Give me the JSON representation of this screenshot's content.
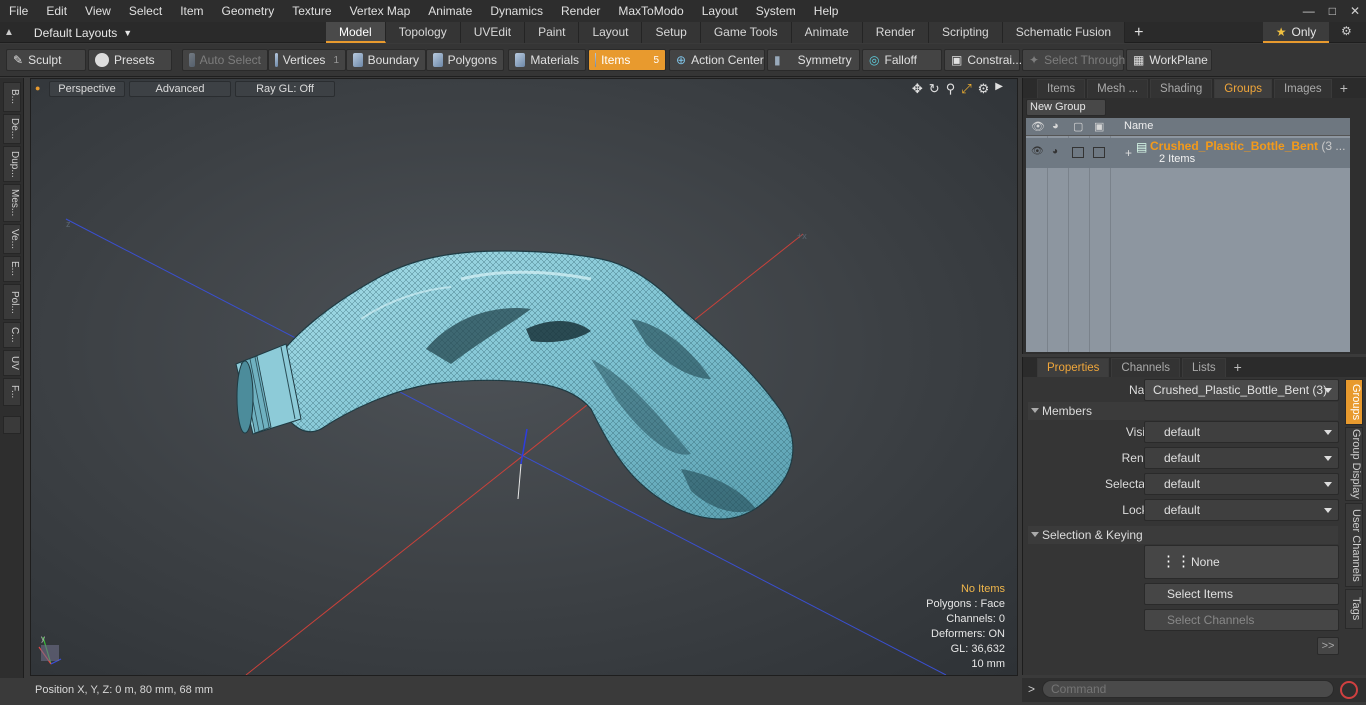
{
  "menu": [
    "File",
    "Edit",
    "View",
    "Select",
    "Item",
    "Geometry",
    "Texture",
    "Vertex Map",
    "Animate",
    "Dynamics",
    "Render",
    "MaxToModo",
    "Layout",
    "System",
    "Help"
  ],
  "layouts_label": "Default Layouts",
  "mode_tabs": [
    "Model",
    "Topology",
    "UVEdit",
    "Paint",
    "Layout",
    "Setup",
    "Game Tools",
    "Animate",
    "Render",
    "Scripting",
    "Schematic Fusion"
  ],
  "active_mode_tab": "Model",
  "only_label": "Only",
  "toolbar": {
    "sculpt": "Sculpt",
    "presets": "Presets",
    "auto_select": "Auto Select",
    "vertices": "Vertices",
    "vertices_count": "1",
    "boundary": "Boundary",
    "polygons": "Polygons",
    "materials": "Materials",
    "items": "Items",
    "items_count": "5",
    "action_center": "Action Center",
    "symmetry": "Symmetry",
    "falloff": "Falloff",
    "constraints": "Constrai...",
    "select_through": "Select Through",
    "workplane": "WorkPlane"
  },
  "left_tabs": [
    "B...",
    "De...",
    "Dup...",
    "Mes...",
    "Ve...",
    "E...",
    "Pol...",
    "C...",
    "UV",
    "F..."
  ],
  "viewport": {
    "view": "Perspective",
    "shading": "Advanced",
    "raygl": "Ray GL: Off",
    "info": {
      "selection": "No Items",
      "polygons": "Polygons : Face",
      "channels": "Channels: 0",
      "deformers": "Deformers: ON",
      "gl": "GL: 36,632",
      "scale": "10 mm"
    }
  },
  "status": "Position X, Y, Z:   0 m, 80 mm, 68 mm",
  "top_panel": {
    "tabs": [
      "Items",
      "Mesh ...",
      "Shading",
      "Groups",
      "Images"
    ],
    "active_tab": "Groups",
    "new_group": "New Group",
    "col_name": "Name",
    "group_name": "Crushed_Plastic_Bottle_Bent",
    "group_count": "(3 ...",
    "group_items": "2 Items"
  },
  "bottom_panel": {
    "tabs": [
      "Properties",
      "Channels",
      "Lists"
    ],
    "active_tab": "Properties",
    "name_label": "Name",
    "name_value": "Crushed_Plastic_Bottle_Bent (3)",
    "members": "Members",
    "visible_label": "Visible",
    "visible_value": "default",
    "render_label": "Render",
    "render_value": "default",
    "selectable_label": "Selectable",
    "selectable_value": "default",
    "locked_label": "Locked",
    "locked_value": "default",
    "selection_keying": "Selection & Keying",
    "none_btn": "None",
    "select_items": "Select Items",
    "select_channels": "Select Channels",
    "more": ">>",
    "vtabs": [
      "Groups",
      "Group Display",
      "User Channels",
      "Tags"
    ]
  },
  "command_placeholder": "Command",
  "colors": {
    "accent": "#e89a2e",
    "bottle": "#86c8d6",
    "group_name": "#f39a1a"
  }
}
